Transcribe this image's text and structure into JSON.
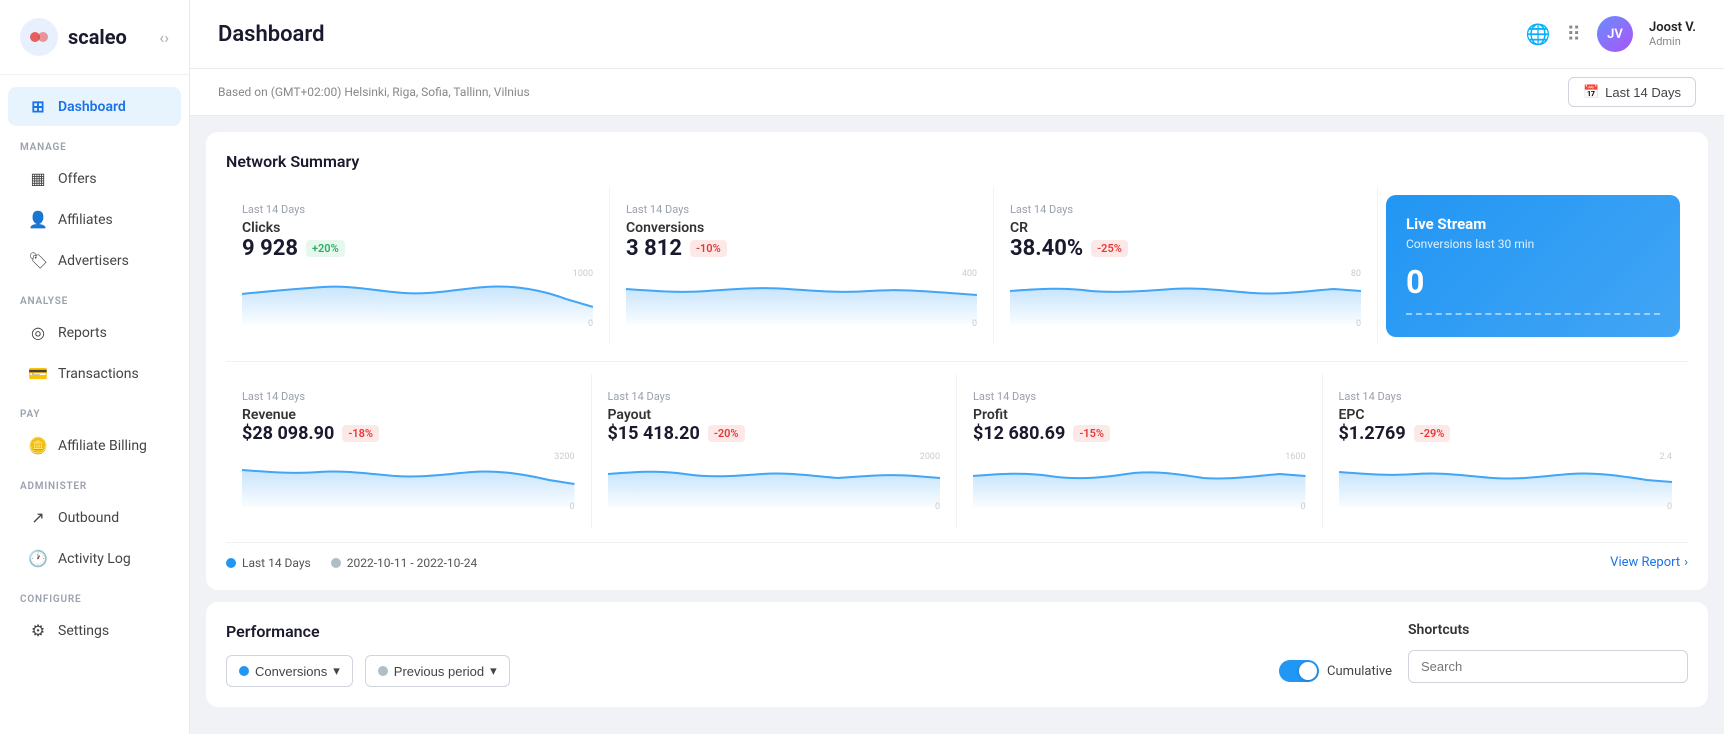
{
  "app": {
    "logo_text": "scaleo",
    "logo_icon": "🔴"
  },
  "sidebar": {
    "manage_label": "MANAGE",
    "analyse_label": "ANALYSE",
    "pay_label": "PAY",
    "administer_label": "ADMINISTER",
    "configure_label": "CONFIGURE",
    "items": {
      "dashboard": "Dashboard",
      "offers": "Offers",
      "affiliates": "Affiliates",
      "advertisers": "Advertisers",
      "reports": "Reports",
      "transactions": "Transactions",
      "affiliate_billing": "Affiliate Billing",
      "outbound": "Outbound",
      "activity_log": "Activity Log",
      "settings": "Settings"
    }
  },
  "header": {
    "title": "Dashboard",
    "user_name": "Joost V.",
    "user_role": "Admin"
  },
  "timezone_bar": {
    "text": "Based on (GMT+02:00) Helsinki, Riga, Sofia, Tallinn, Vilnius",
    "date_range_btn": "Last 14 Days"
  },
  "network_summary": {
    "title": "Network Summary",
    "metrics": [
      {
        "label": "Clicks",
        "period": "Last 14 Days",
        "value": "9 928",
        "badge": "+20%",
        "badge_type": "green",
        "max_label": "1000",
        "min_label": "0"
      },
      {
        "label": "Conversions",
        "period": "Last 14 Days",
        "value": "3 812",
        "badge": "-10%",
        "badge_type": "red",
        "max_label": "400",
        "min_label": "0"
      },
      {
        "label": "CR",
        "period": "Last 14 Days",
        "value": "38.40%",
        "badge": "-25%",
        "badge_type": "red",
        "max_label": "80",
        "min_label": "0"
      }
    ],
    "revenue_metrics": [
      {
        "label": "Revenue",
        "period": "Last 14 Days",
        "value": "$28 098.90",
        "badge": "-18%",
        "badge_type": "red",
        "max_label": "3200",
        "min_label": "0"
      },
      {
        "label": "Payout",
        "period": "Last 14 Days",
        "value": "$15 418.20",
        "badge": "-20%",
        "badge_type": "red",
        "max_label": "2000",
        "min_label": "0"
      },
      {
        "label": "Profit",
        "period": "Last 14 Days",
        "value": "$12 680.69",
        "badge": "-15%",
        "badge_type": "red",
        "max_label": "1600",
        "min_label": "0"
      },
      {
        "label": "EPC",
        "period": "Last 14 Days",
        "value": "$1.2769",
        "badge": "-29%",
        "badge_type": "red",
        "max_label": "2.4",
        "min_label": "0"
      }
    ],
    "live_stream": {
      "title": "Live Stream",
      "subtitle": "Conversions last 30 min",
      "value": "0"
    },
    "legend": {
      "dot1_label": "Last 14 Days",
      "dot2_label": "2022-10-11 - 2022-10-24"
    },
    "view_report": "View Report"
  },
  "performance": {
    "title": "Performance",
    "dropdown1_label": "Conversions",
    "dropdown2_label": "Previous period",
    "toggle_label": "Cumulative"
  },
  "shortcuts": {
    "title": "Shortcuts",
    "search_placeholder": "Search"
  }
}
